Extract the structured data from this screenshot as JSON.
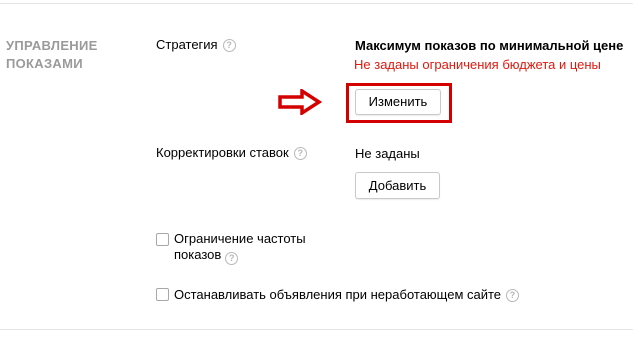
{
  "section": {
    "title_line1": "УПРАВЛЕНИЕ",
    "title_line2": "ПОКАЗАМИ"
  },
  "strategy": {
    "label": "Стратегия",
    "help": "?",
    "value": "Максимум показов по минимальной цене",
    "warning": "Не заданы ограничения бюджета и цены",
    "change_button": "Изменить"
  },
  "bid_adjustments": {
    "label": "Корректировки ставок",
    "help": "?",
    "value": "Не заданы",
    "add_button": "Добавить"
  },
  "frequency_limit": {
    "label_line1": "Ограничение частоты",
    "label_line2": "показов",
    "help": "?",
    "checked": false
  },
  "stop_ads": {
    "label": "Останавливать объявления при неработающем сайте",
    "help": "?",
    "checked": false
  },
  "annotation": {
    "arrow_icon": "right-arrow-icon",
    "highlight_color": "#d40000"
  },
  "colors": {
    "warning": "#e0190f",
    "section_title": "#9a9a9a"
  }
}
